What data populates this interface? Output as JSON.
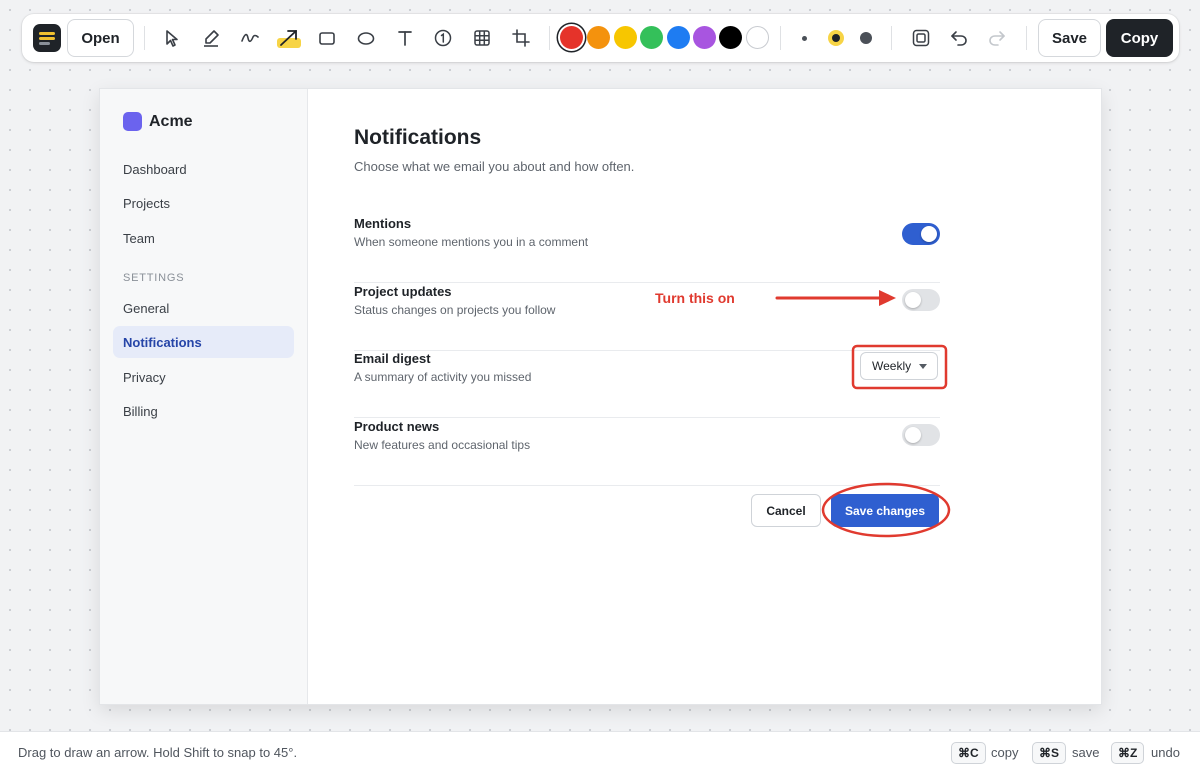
{
  "toolbar": {
    "open_label": "Open",
    "tools": [
      "select-pointer-icon",
      "highlighter-icon",
      "freehand-icon",
      "arrow-icon",
      "rectangle-icon",
      "ellipse-icon",
      "text-icon",
      "step-number-icon",
      "pixelate-icon",
      "crop-icon"
    ],
    "active_tool": "arrow-icon",
    "colors": [
      "#e5332a",
      "#f4920d",
      "#f7c600",
      "#34c05a",
      "#1e7cf2",
      "#a855e0",
      "#000000",
      "#ffffff"
    ],
    "selected_color": "#e5332a",
    "stroke_sizes": [
      "small",
      "medium",
      "large"
    ],
    "selected_stroke": "medium",
    "save_label": "Save",
    "copy_label": "Copy"
  },
  "screenshot": {
    "brand": {
      "name": "Acme",
      "color": "#6b63ee"
    },
    "nav_items": [
      "Dashboard",
      "Projects",
      "Team"
    ],
    "settings_section": "SETTINGS",
    "settings_items": [
      "General",
      "Notifications",
      "Privacy",
      "Billing"
    ],
    "active_item": "Notifications",
    "page": {
      "title": "Notifications",
      "subtitle": "Choose what we email you about and how often."
    },
    "settings": [
      {
        "title": "Mentions",
        "description": "When someone mentions you in a comment",
        "control": "toggle",
        "on": true
      },
      {
        "title": "Project updates",
        "description": "Status changes on projects you follow",
        "control": "toggle",
        "on": false
      },
      {
        "title": "Email digest",
        "description": "A summary of activity you missed",
        "control": "select",
        "value": "Weekly"
      },
      {
        "title": "Product news",
        "description": "New features and occasional tips",
        "control": "toggle",
        "on": false
      }
    ],
    "cancel_label": "Cancel",
    "save_changes_label": "Save changes",
    "accent_color": "#2f5fd0"
  },
  "annotations": {
    "color": "#e03a2f",
    "callout_text": "Turn this on"
  },
  "statusbar": {
    "hint": "Drag to draw an arrow. Hold Shift to snap to 45°.",
    "shortcuts": [
      {
        "key": "⌘C",
        "action": "copy"
      },
      {
        "key": "⌘S",
        "action": "save"
      },
      {
        "key": "⌘Z",
        "action": "undo"
      }
    ]
  }
}
